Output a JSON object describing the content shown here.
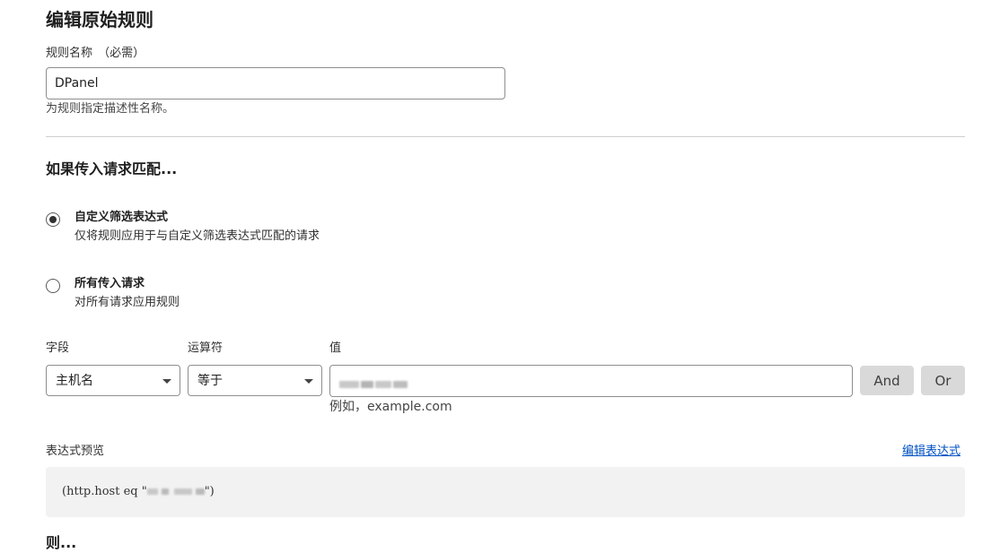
{
  "page": {
    "title": "编辑原始规则"
  },
  "rule_name": {
    "label": "规则名称",
    "required_note": "（必需）",
    "value": "DPanel",
    "hint": "为规则指定描述性名称。"
  },
  "match_section": {
    "title": "如果传入请求匹配...",
    "options": [
      {
        "title": "自定义筛选表达式",
        "description": "仅将规则应用于与自定义筛选表达式匹配的请求",
        "selected": true
      },
      {
        "title": "所有传入请求",
        "description": "对所有请求应用规则",
        "selected": false
      }
    ]
  },
  "filter": {
    "field_label": "字段",
    "field_value": "主机名",
    "operator_label": "运算符",
    "operator_value": "等于",
    "value_label": "值",
    "value_hint": "例如，example.com",
    "and_label": "And",
    "or_label": "Or"
  },
  "expression_preview": {
    "label": "表达式预览",
    "edit_link": "编辑表达式",
    "code_prefix": "(http.host eq \"",
    "code_suffix": "\")"
  },
  "then_section": {
    "title": "则..."
  }
}
